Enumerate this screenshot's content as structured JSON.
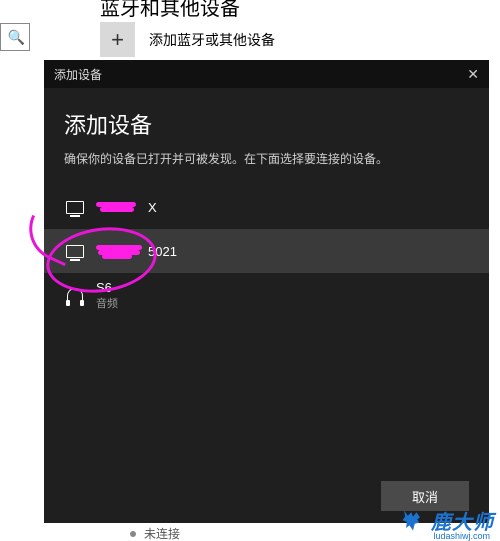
{
  "page": {
    "cropped_heading": "蓝牙和其他设备",
    "add_device_label": "添加蓝牙或其他设备"
  },
  "dialog": {
    "titlebar": "添加设备",
    "heading": "添加设备",
    "subtitle": "确保你的设备已打开并可被发现。在下面选择要连接的设备。",
    "devices": [
      {
        "name_suffix": "X"
      },
      {
        "name_suffix": "5021"
      },
      {
        "name": "S6",
        "subtitle": "音频"
      }
    ],
    "cancel": "取消"
  },
  "footer": {
    "status": "未连接"
  },
  "branding": {
    "text": "鹿大师",
    "url": "ludashiwj.com"
  }
}
